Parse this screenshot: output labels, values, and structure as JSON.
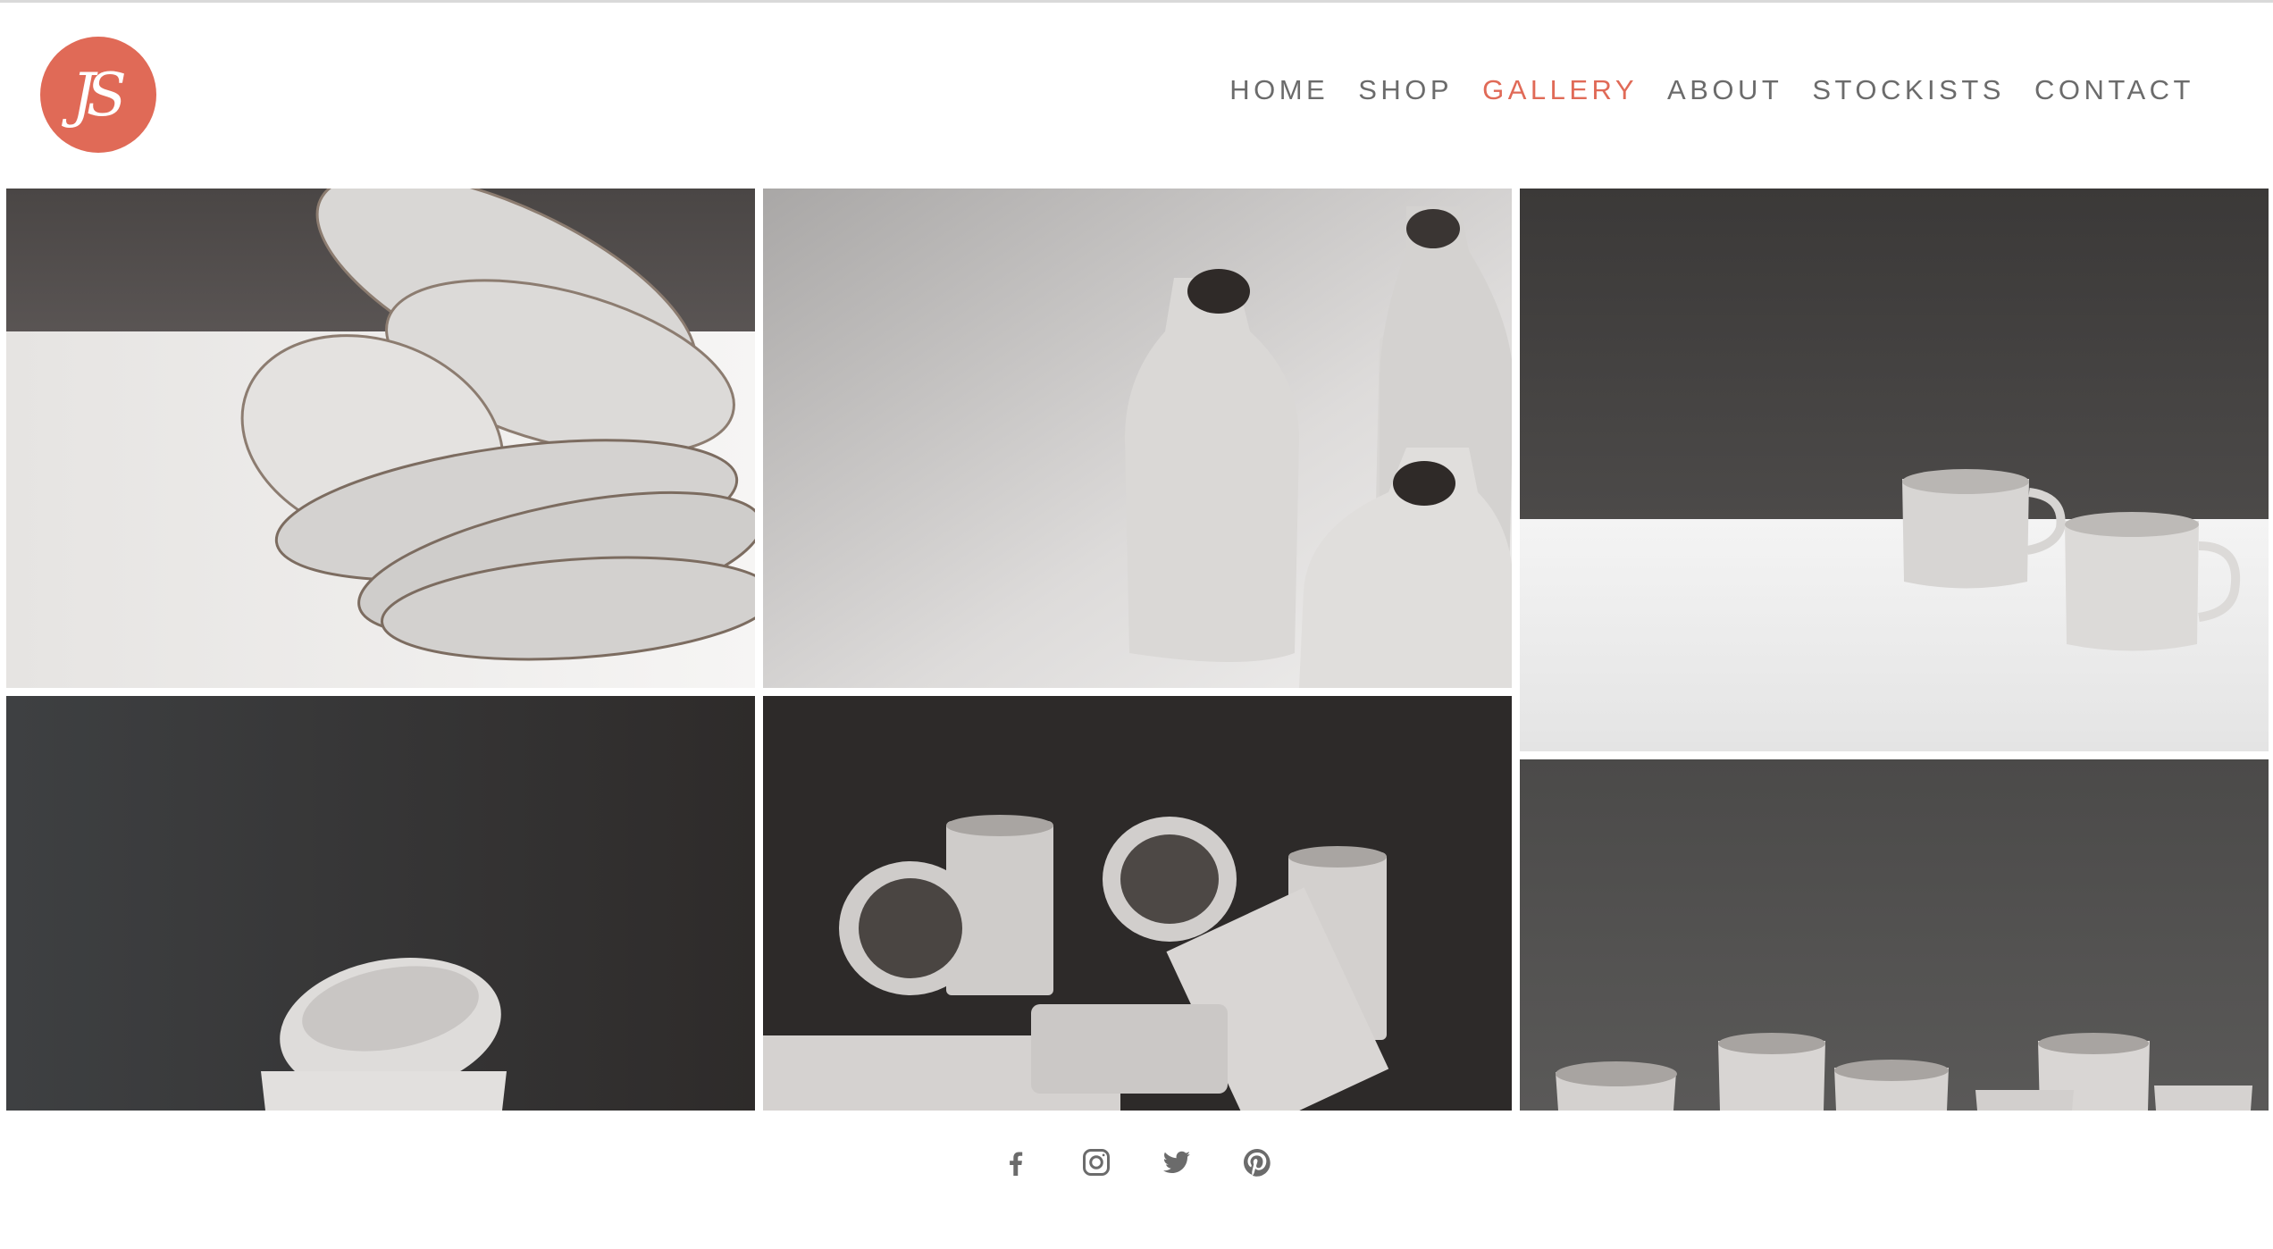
{
  "brand": {
    "logo_text": "JS",
    "accent_color": "#e06a57"
  },
  "nav": {
    "items": [
      {
        "label": "HOME",
        "active": false
      },
      {
        "label": "SHOP",
        "active": false
      },
      {
        "label": "GALLERY",
        "active": true
      },
      {
        "label": "ABOUT",
        "active": false
      },
      {
        "label": "STOCKISTS",
        "active": false
      },
      {
        "label": "CONTACT",
        "active": false
      }
    ]
  },
  "gallery": {
    "tiles": [
      {
        "subject": "stacked white speckled bowls"
      },
      {
        "subject": "three speckled bottle vases"
      },
      {
        "subject": "two speckled mugs on white surface"
      },
      {
        "subject": "stacked small bowls on dark background"
      },
      {
        "subject": "pile of speckled cylindrical vases"
      },
      {
        "subject": "group of small speckled cups"
      }
    ]
  },
  "social": {
    "icons": [
      "facebook-icon",
      "instagram-icon",
      "twitter-icon",
      "pinterest-icon"
    ],
    "icon_color": "#6b6b6b"
  }
}
